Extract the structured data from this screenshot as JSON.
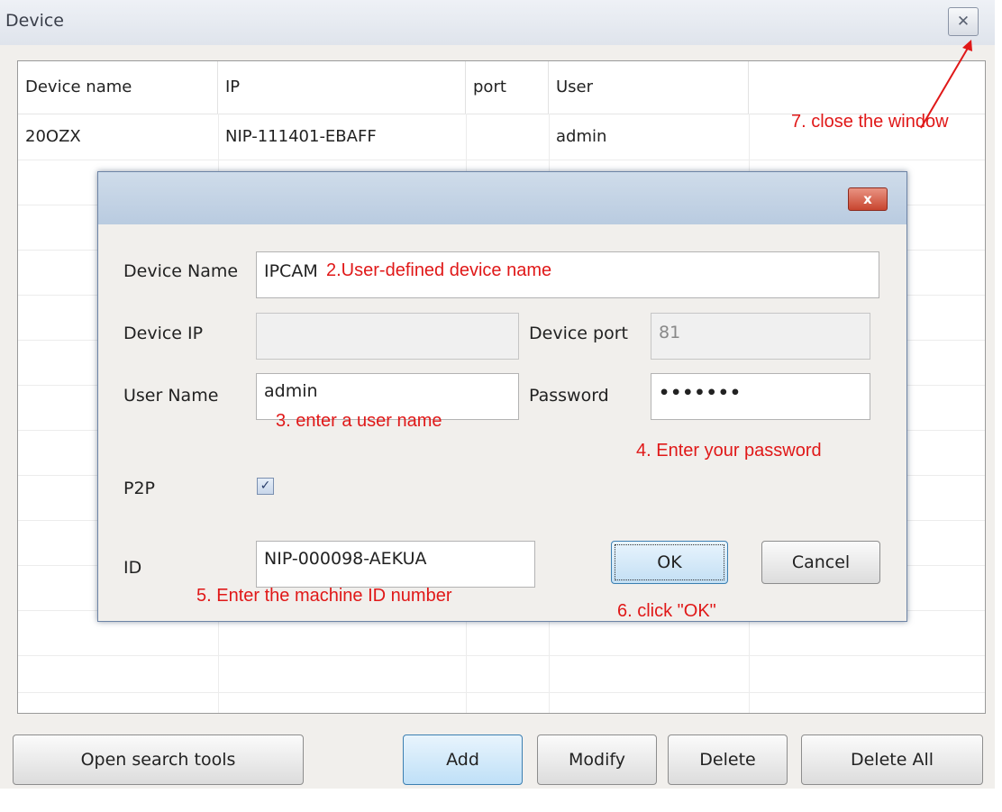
{
  "window": {
    "title": "Device",
    "close_icon": "✕"
  },
  "table": {
    "columns": [
      "Device name",
      "IP",
      "port",
      "User",
      ""
    ],
    "rows": [
      {
        "name": "20OZX",
        "ip": "NIP-111401-EBAFF",
        "port": "",
        "user": "admin"
      }
    ]
  },
  "buttons": {
    "open_search_tools": "Open search tools",
    "add": "Add",
    "modify": "Modify",
    "delete": "Delete",
    "delete_all": "Delete All"
  },
  "dialog": {
    "close_icon": "x",
    "device_name_label": "Device Name",
    "device_name_value": "IPCAM",
    "device_ip_label": "Device IP",
    "device_ip_value": "",
    "device_port_label": "Device port",
    "device_port_value": "81",
    "user_name_label": "User Name",
    "user_name_value": "admin",
    "password_label": "Password",
    "password_value": "•••••••",
    "p2p_label": "P2P",
    "p2p_checked": true,
    "id_label": "ID",
    "id_value": "NIP-000098-AEKUA",
    "ok_label": "OK",
    "cancel_label": "Cancel"
  },
  "annotations": {
    "a2": "2.User-defined device name",
    "a3": "3. enter a user name",
    "a4": "4. Enter your password",
    "a5": "5. Enter the machine ID number",
    "a6": "6. click \"OK\"",
    "a7": "7. close the window"
  },
  "colors": {
    "annotation": "#e01818",
    "dialog_close": "#c8452f",
    "primary_button": "#bfe0f7"
  }
}
